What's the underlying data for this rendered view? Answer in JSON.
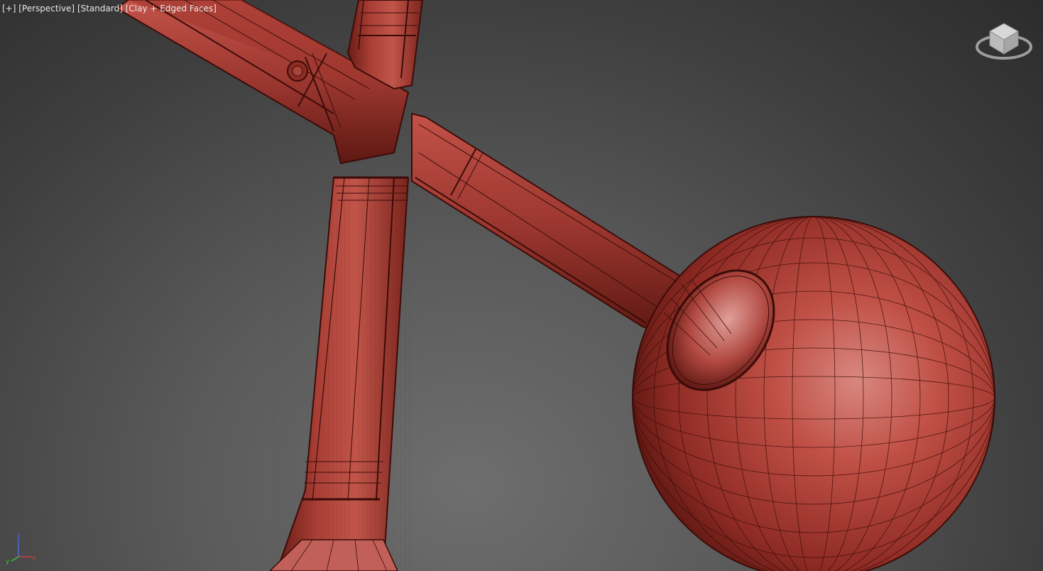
{
  "viewport": {
    "labels": {
      "plus": "[+]",
      "view": "[Perspective]",
      "shading_preset": "[Standard]",
      "visual_style": "[Clay + Edged Faces]"
    }
  },
  "viewcube": {
    "icon": "viewcube-icon",
    "compass_icon": "compass-ring-icon"
  },
  "axis_tripod": {
    "z": "z",
    "y": "y",
    "x": "x",
    "colors": {
      "x": "#d04040",
      "y": "#3fbf3f",
      "z": "#4a6ad8"
    }
  },
  "scene": {
    "objects": [
      "frame-tube-left",
      "frame-tube-vertical",
      "frame-tube-right",
      "sphere-ball",
      "bolt-head"
    ],
    "clay_color": "#b84a40",
    "edge_color": "#3a0c08",
    "background_top": "#2c2c2c",
    "background_bottom": "#6e6e6e"
  }
}
